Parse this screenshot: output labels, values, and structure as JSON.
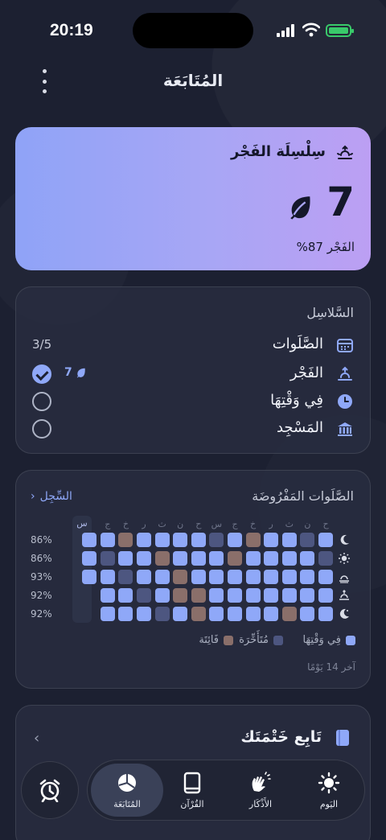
{
  "status": {
    "time": "20:19"
  },
  "header": {
    "title": "المُتَابَعَة"
  },
  "streak_card": {
    "title": "سِلْسِلَة الفَجْر",
    "count": "7",
    "subtitle": "الفَجْر 87%"
  },
  "chains": {
    "header": "السَّلاسِل",
    "progress": "3/5",
    "items": [
      {
        "label": "الصَّلَوات",
        "icon": "calendar-icon",
        "done": false,
        "streak": ""
      },
      {
        "label": "الفَجْر",
        "icon": "sunrise-icon",
        "done": true,
        "streak": "7"
      },
      {
        "label": "فِي وَقْتِهَا",
        "icon": "clock-icon",
        "done": false,
        "streak": ""
      },
      {
        "label": "المَسْجِد",
        "icon": "mosque-icon",
        "done": false,
        "streak": ""
      }
    ]
  },
  "prayers": {
    "header": "الصَّلَوات المَفْرُوضَة",
    "log_link": "السِّجِل",
    "day_labels": [
      "ح",
      "ن",
      "ث",
      "ر",
      "خ",
      "ج",
      "س",
      "ح",
      "ن",
      "ث",
      "ر",
      "خ",
      "ج",
      "س"
    ],
    "today_label": "س",
    "rows": [
      {
        "pct": "86%",
        "icon": "moon-icon",
        "cells": [
          "o",
          "l",
          "o",
          "o",
          "m",
          "o",
          "l",
          "o",
          "o",
          "o",
          "o",
          "m",
          "o",
          "o"
        ]
      },
      {
        "pct": "86%",
        "icon": "sun-icon",
        "cells": [
          "l",
          "o",
          "o",
          "o",
          "o",
          "m",
          "o",
          "o",
          "o",
          "m",
          "o",
          "o",
          "l",
          "o"
        ]
      },
      {
        "pct": "93%",
        "icon": "sunset-icon",
        "cells": [
          "o",
          "o",
          "o",
          "o",
          "o",
          "o",
          "o",
          "o",
          "m",
          "o",
          "o",
          "l",
          "o",
          "o"
        ]
      },
      {
        "pct": "92%",
        "icon": "sunrise-icon",
        "cells": [
          "o",
          "o",
          "o",
          "o",
          "o",
          "o",
          "o",
          "m",
          "m",
          "o",
          "l",
          "o",
          "o",
          "x"
        ]
      },
      {
        "pct": "92%",
        "icon": "crescent-icon",
        "cells": [
          "o",
          "o",
          "m",
          "o",
          "o",
          "o",
          "o",
          "m",
          "o",
          "l",
          "o",
          "o",
          "o",
          "x"
        ]
      }
    ],
    "legend": {
      "on_time": "فِي وَقْتِهَا",
      "late": "مُتَأَخِّرَة",
      "missed": "فَائِتَة"
    },
    "footer": "آخر 14 يَوْمًا",
    "colors": {
      "on_time": "#8fa8f8",
      "late": "#4d5680",
      "missed": "#8a6f6a",
      "empty": "#3a4158"
    }
  },
  "khatma": {
    "title": "تَابِع خَتْمَتَك"
  },
  "tabbar": {
    "tabs": [
      {
        "label": "اليَوم",
        "icon": "sun-icon"
      },
      {
        "label": "الأَذْكَار",
        "icon": "hands-icon"
      },
      {
        "label": "القُرْآن",
        "icon": "book-icon"
      },
      {
        "label": "المُتَابَعَة",
        "icon": "pie-chart-icon"
      }
    ],
    "active": "المُتَابَعَة"
  }
}
